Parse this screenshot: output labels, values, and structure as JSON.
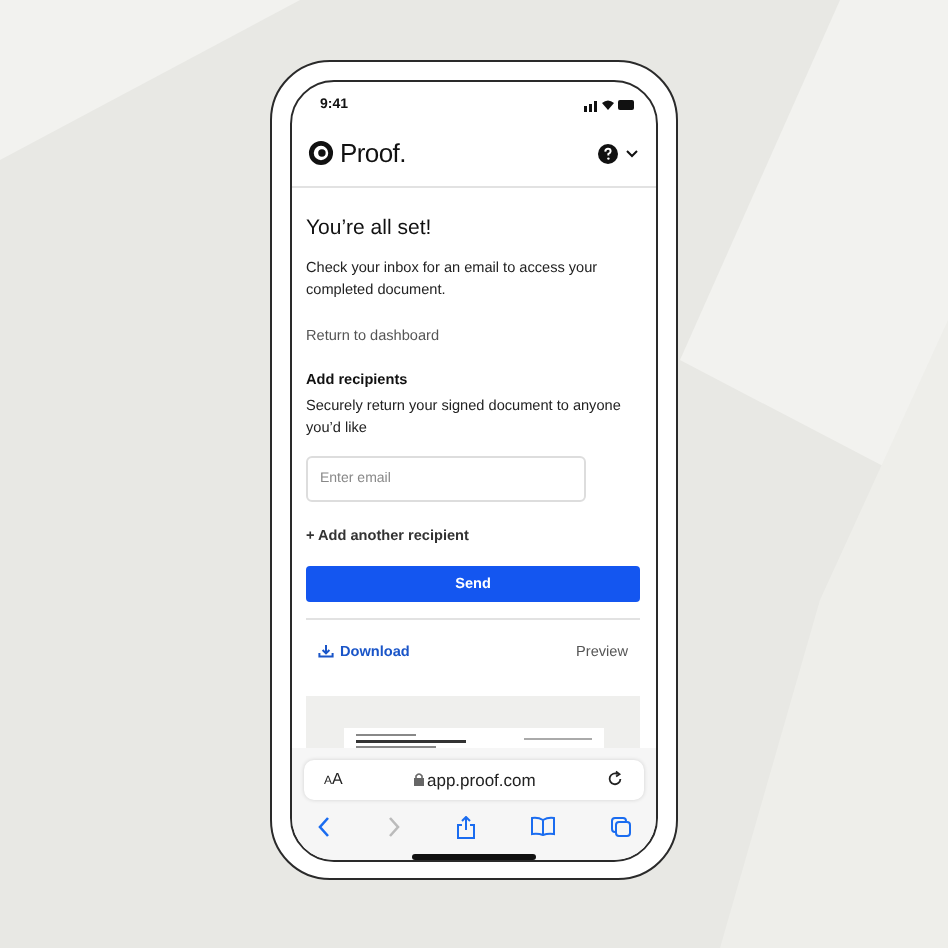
{
  "status_bar": {
    "time": "9:41"
  },
  "header": {
    "brand": "Proof."
  },
  "confirmation": {
    "title": "You’re all set!",
    "message": "Check your inbox for an email to access your completed document.",
    "link": "Return to dashboard"
  },
  "recipients": {
    "heading": "Add recipients",
    "description": "Securely return your signed document to anyone you’d like",
    "email_field": {
      "placeholder": "Enter email"
    },
    "add_link": "+ Add another recipient",
    "send_button": "Send"
  },
  "document_actions": {
    "download": "Download",
    "preview": "Preview"
  },
  "browser": {
    "text_size": "AA",
    "url": "app.proof.com"
  }
}
